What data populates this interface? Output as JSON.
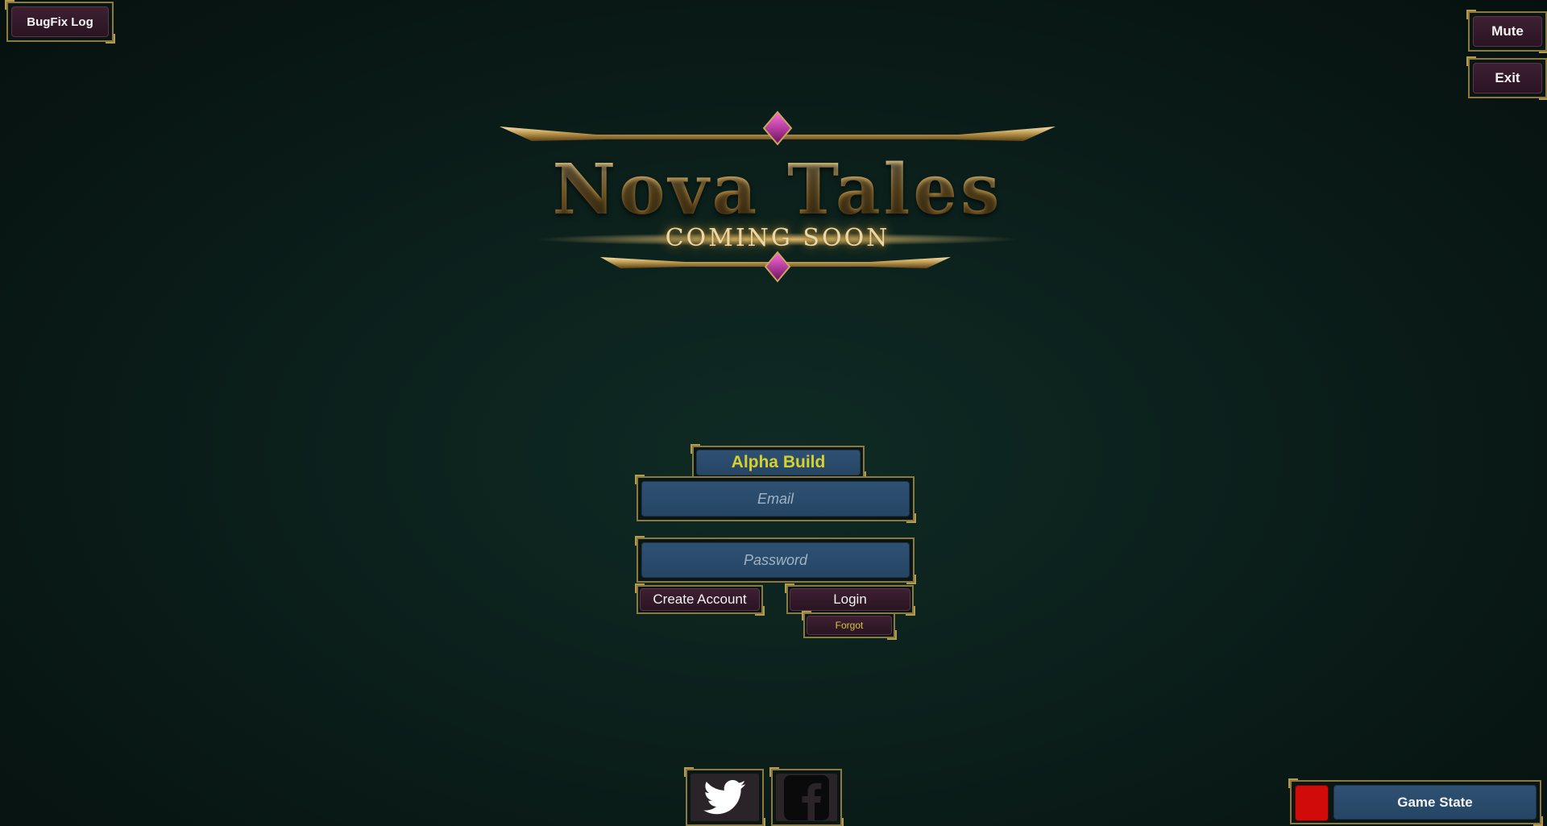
{
  "app": {
    "title": "Nova Tales",
    "subtitle": "COMING SOON"
  },
  "top_left": {
    "bugfix_label": "BugFix Log"
  },
  "top_right": {
    "mute_label": "Mute",
    "exit_label": "Exit"
  },
  "login": {
    "build_label": "Alpha Build",
    "email_placeholder": "Email",
    "password_placeholder": "Password",
    "create_account_label": "Create Account",
    "login_label": "Login",
    "forgot_label": "Forgot"
  },
  "social": {
    "twitter_icon": "twitter-icon",
    "facebook_icon": "facebook-icon"
  },
  "game_state": {
    "label": "Game State",
    "indicator_color": "#d10a0a"
  },
  "colors": {
    "accent_gold": "#b59b4c",
    "button_plum": "#3d2032",
    "field_slate": "#2f5172",
    "build_text": "#d6d12c"
  }
}
